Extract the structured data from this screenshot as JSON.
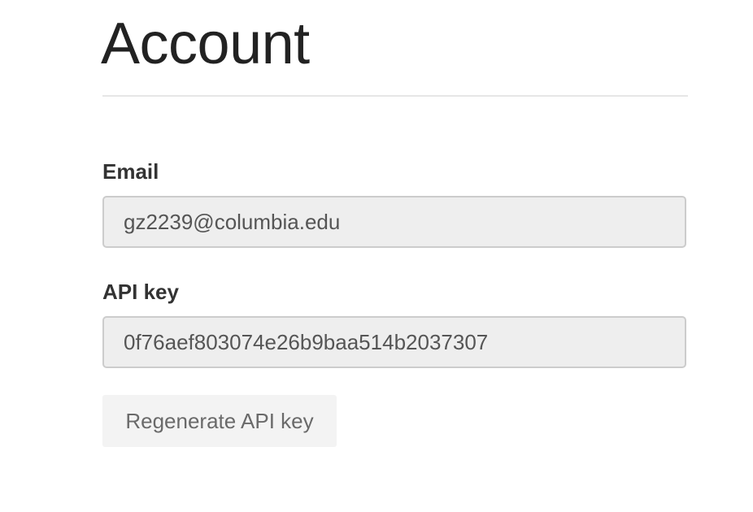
{
  "page": {
    "title": "Account"
  },
  "form": {
    "email": {
      "label": "Email",
      "value": "gz2239@columbia.edu"
    },
    "api_key": {
      "label": "API key",
      "value": "0f76aef803074e26b9baa514b2037307"
    },
    "regenerate_button": {
      "label": "Regenerate API key"
    }
  },
  "colors": {
    "input_background": "#eeeeee",
    "input_border": "#cccccc",
    "button_background": "#f3f3f3",
    "divider": "#e6e6e6"
  }
}
